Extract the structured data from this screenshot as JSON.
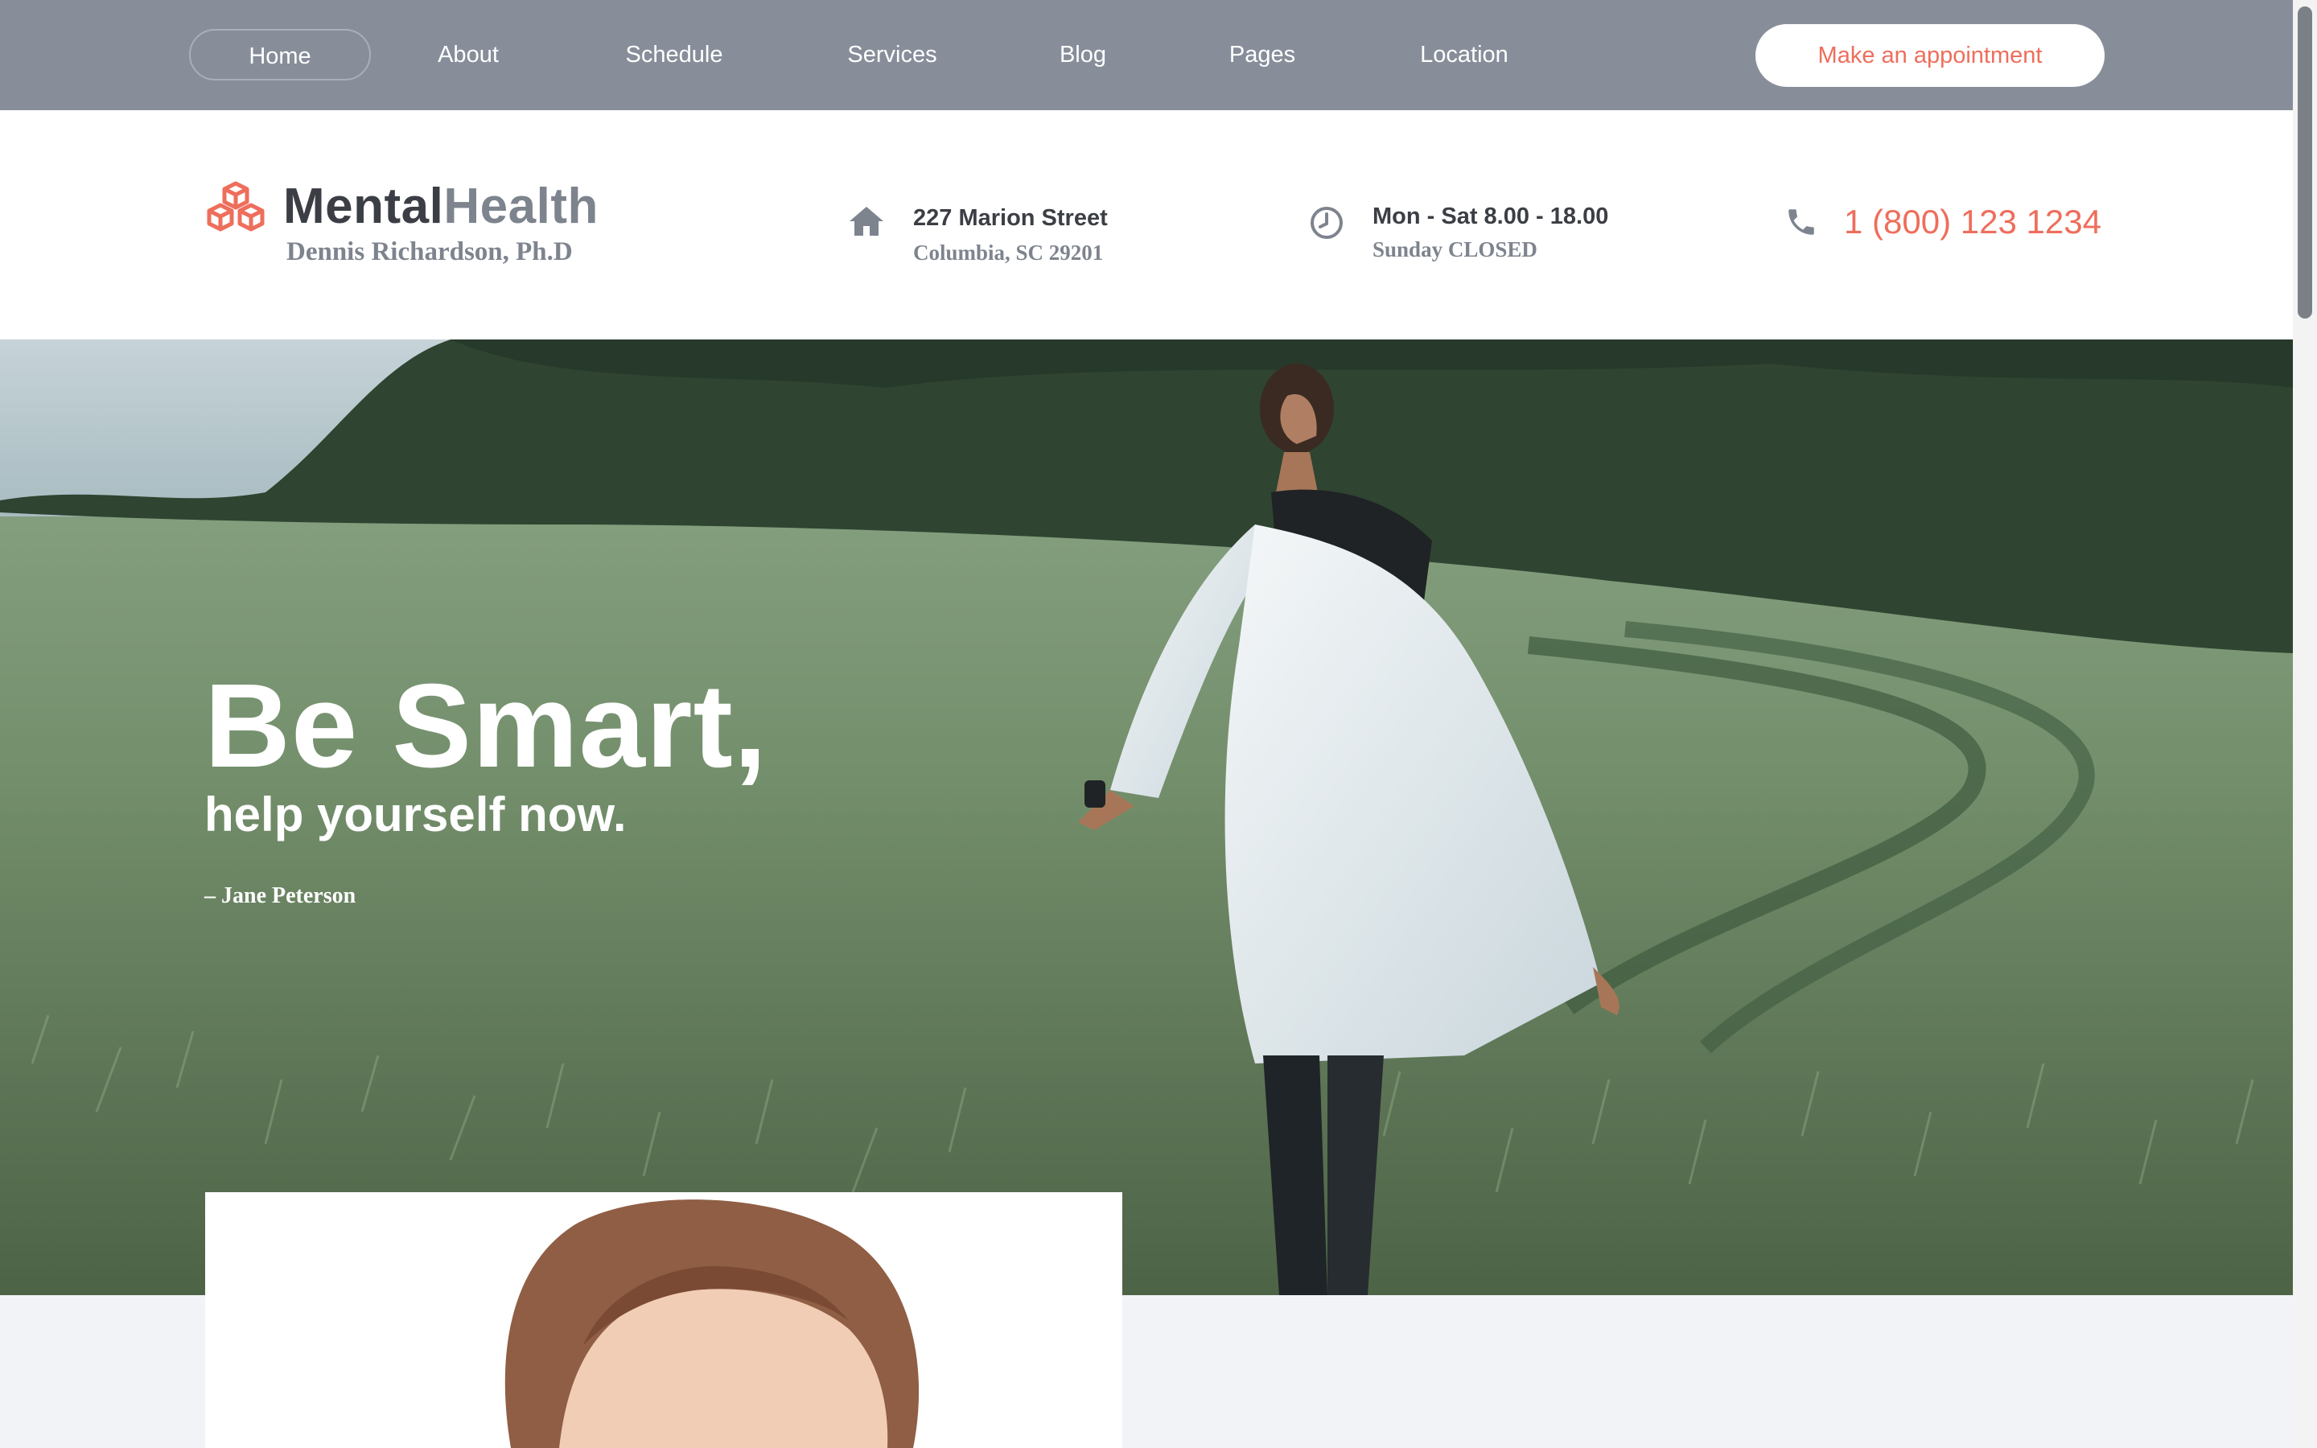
{
  "nav": {
    "items": [
      {
        "label": "Home",
        "active": true
      },
      {
        "label": "About"
      },
      {
        "label": "Schedule"
      },
      {
        "label": "Services"
      },
      {
        "label": "Blog"
      },
      {
        "label": "Pages"
      },
      {
        "label": "Location"
      }
    ],
    "cta_label": "Make an appointment"
  },
  "brand": {
    "name_part1": "Mental",
    "name_part2": "Health",
    "subtitle": "Dennis Richardson, Ph.D",
    "logo_icon": "cubes-icon"
  },
  "contact": {
    "address_line1": "227 Marion Street",
    "address_line2": "Columbia, SC 29201",
    "hours_line1": "Mon - Sat 8.00 - 18.00",
    "hours_line2": "Sunday CLOSED",
    "phone": "1 (800) 123 1234",
    "icons": [
      "home-icon",
      "clock-icon",
      "phone-icon"
    ]
  },
  "hero": {
    "title": "Be Smart,",
    "subtitle": "help yourself now.",
    "quote": "– Jane Peterson"
  },
  "colors": {
    "topbar": "#878e9a",
    "accent": "#ee6e5c",
    "text_dark": "#3b3e44",
    "text_muted": "#7e848e",
    "page_bg": "#f2f3f6"
  }
}
